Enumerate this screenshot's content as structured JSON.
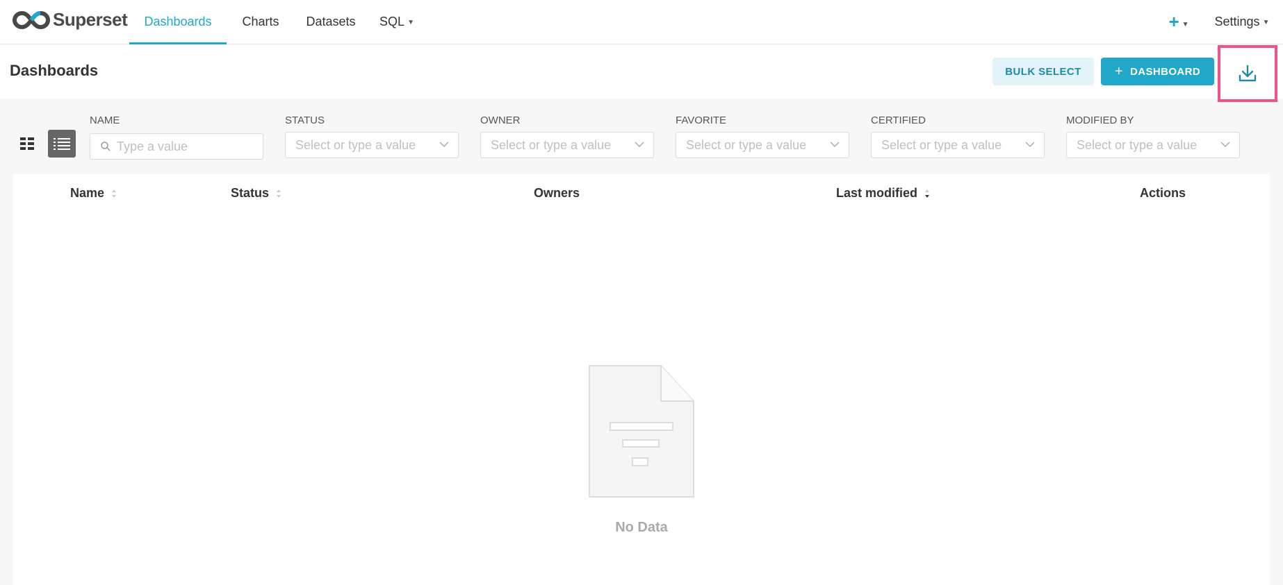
{
  "nav": {
    "brand": "Superset",
    "items": [
      {
        "label": "Dashboards",
        "active": true
      },
      {
        "label": "Charts"
      },
      {
        "label": "Datasets"
      },
      {
        "label": "SQL",
        "dropdown": true
      }
    ],
    "right": {
      "plus": "+",
      "settings": "Settings"
    }
  },
  "header": {
    "title": "Dashboards",
    "bulk_select": "BULK SELECT",
    "add_dashboard": "DASHBOARD",
    "download_icon": "download-icon",
    "highlight_color": "#f0528a"
  },
  "filters": [
    {
      "label": "NAME",
      "placeholder": "Type a value"
    },
    {
      "label": "STATUS",
      "placeholder": "Select or type a value"
    },
    {
      "label": "OWNER",
      "placeholder": "Select or type a value"
    },
    {
      "label": "FAVORITE",
      "placeholder": "Select or type a value"
    },
    {
      "label": "CERTIFIED",
      "placeholder": "Select or type a value"
    },
    {
      "label": "MODIFIED BY",
      "placeholder": "Select or type a value"
    }
  ],
  "table": {
    "columns": [
      "Name",
      "Status",
      "Owners",
      "Last modified",
      "Actions"
    ],
    "empty_text": "No Data"
  },
  "colors": {
    "accent": "#20a7c9",
    "accent_light": "#e2f4f9"
  }
}
